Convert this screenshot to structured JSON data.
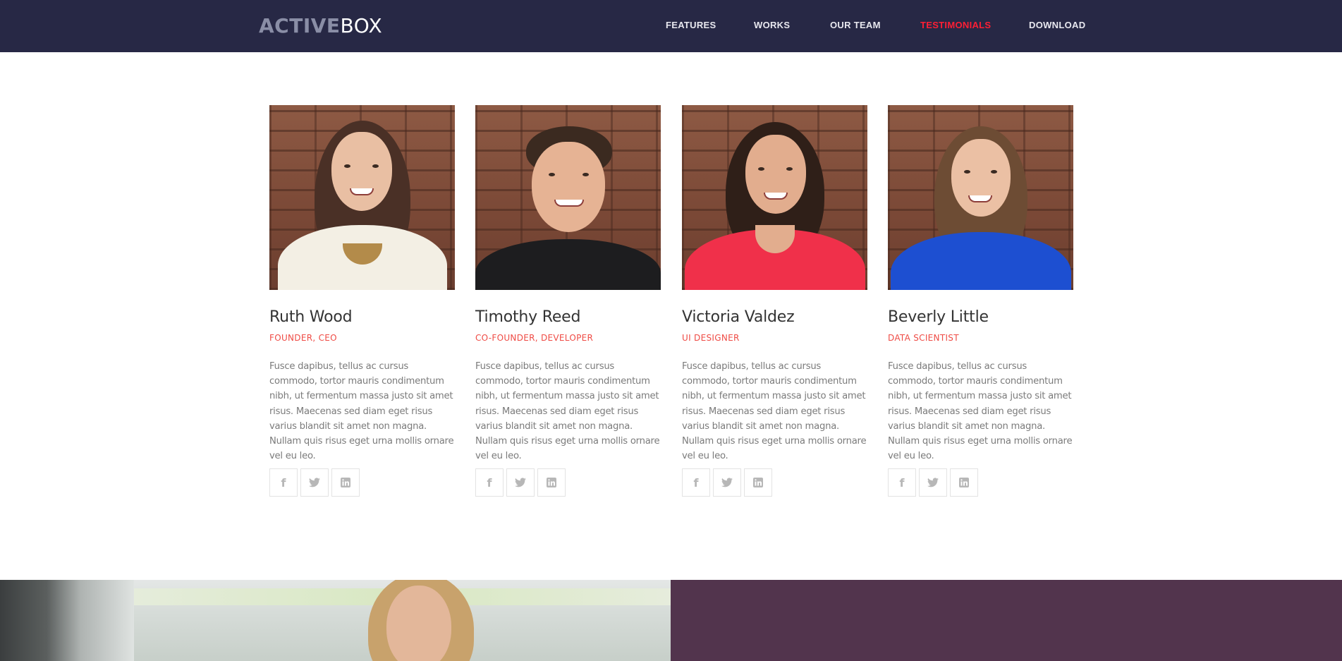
{
  "brand": {
    "logo_bold": "ACTIVE",
    "logo_light": "BOX"
  },
  "nav": {
    "items": [
      {
        "label": "FEATURES",
        "active": false
      },
      {
        "label": "WORKS",
        "active": false
      },
      {
        "label": "OUR TEAM",
        "active": false
      },
      {
        "label": "TESTIMONIALS",
        "active": true
      },
      {
        "label": "DOWNLOAD",
        "active": false
      }
    ]
  },
  "team": {
    "members": [
      {
        "name": "Ruth Wood",
        "role": "FOUNDER, CEO",
        "bio": "Fusce dapibus, tellus ac cursus commodo, tortor mauris condimentum nibh, ut fermentum massa justo sit amet risus. Maecenas sed diam eget risus varius blandit sit amet non magna. Nullam quis risus eget urna mollis ornare vel eu leo.",
        "socials": [
          "facebook-icon",
          "twitter-icon",
          "linkedin-icon"
        ]
      },
      {
        "name": "Timothy Reed",
        "role": "CO-FOUNDER, DEVELOPER",
        "bio": "Fusce dapibus, tellus ac cursus commodo, tortor mauris condimentum nibh, ut fermentum massa justo sit amet risus. Maecenas sed diam eget risus varius blandit sit amet non magna. Nullam quis risus eget urna mollis ornare vel eu leo.",
        "socials": [
          "facebook-icon",
          "twitter-icon",
          "linkedin-icon"
        ]
      },
      {
        "name": "Victoria Valdez",
        "role": "UI DESIGNER",
        "bio": "Fusce dapibus, tellus ac cursus commodo, tortor mauris condimentum nibh, ut fermentum massa justo sit amet risus. Maecenas sed diam eget risus varius blandit sit amet non magna. Nullam quis risus eget urna mollis ornare vel eu leo.",
        "socials": [
          "facebook-icon",
          "twitter-icon",
          "linkedin-icon"
        ]
      },
      {
        "name": "Beverly Little",
        "role": "DATA SCIENTIST",
        "bio": "Fusce dapibus, tellus ac cursus commodo, tortor mauris condimentum nibh, ut fermentum massa justo sit amet risus. Maecenas sed diam eget risus varius blandit sit amet non magna. Nullam quis risus eget urna mollis ornare vel eu leo.",
        "socials": [
          "facebook-icon",
          "twitter-icon",
          "linkedin-icon"
        ]
      }
    ]
  },
  "colors": {
    "header_bg": "#272845",
    "nav_active": "#ff1e34",
    "role_accent": "#ef4b45",
    "band_right": "#52344d"
  }
}
